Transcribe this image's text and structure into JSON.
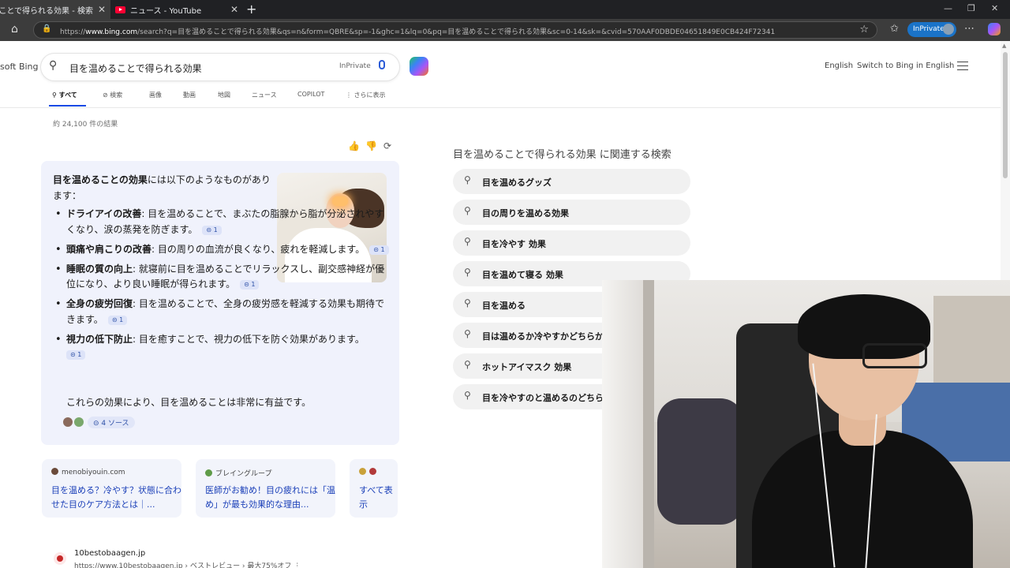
{
  "browser": {
    "tabs": [
      {
        "title": "目を温めることで得られる効果 - 検索"
      },
      {
        "title": "ニュース - YouTube"
      }
    ],
    "url": "https://www.bing.com/search?q=目を温めることで得られる効果&qs=n&form=QBRE&sp=-1&ghc=1&lq=0&pq=目を温めることで得られる効果&sc=0-14&sk=&cvid=570AAF0DBDE04651849E0CB424F72341",
    "url_domain": "www.bing.com",
    "url_prefix": "https://",
    "url_rest": "/search?q=目を温めることで得られる効果&qs=n&form=QBRE&sp=-1&ghc=1&lq=0&pq=目を温めることで得られる効果&sc=0-14&sk=&cvid=570AAF0DBDE04651849E0CB424F72341",
    "inprivate_label": "InPrivate"
  },
  "header": {
    "brand": "soft Bing",
    "query": "目を温めることで得られる効果",
    "inprivate": "InPrivate",
    "language": "English",
    "switch_link": "Switch to Bing in English"
  },
  "search_tabs": [
    "すべて",
    "検索",
    "画像",
    "動画",
    "地図",
    "ニュース",
    "COPILOT",
    "さらに表示"
  ],
  "result_count": "約 24,100 件の結果",
  "answer": {
    "intro_bold": "目を温めることの効果",
    "intro_rest": "には以下のようなものがあります：",
    "items": [
      {
        "title": "ドライアイの改善",
        "text": ": 目を温めることで、まぶたの脂腺から脂が分泌されやすくなり、涙の蒸発を防ぎます。",
        "cite": "1"
      },
      {
        "title": "頭痛や肩こりの改善",
        "text": ": 目の周りの血流が良くなり、疲れを軽減します。",
        "cite": "1"
      },
      {
        "title": "睡眠の質の向上",
        "text": ": 就寝前に目を温めることでリラックスし、副交感神経が優位になり、より良い睡眠が得られます。",
        "cite": "1"
      },
      {
        "title": "全身の疲労回復",
        "text": ": 目を温めることで、全身の疲労感を軽減する効果も期待できます。",
        "cite": "1"
      },
      {
        "title": "視力の低下防止",
        "text": ": 目を癒すことで、視力の低下を防ぐ効果があります。",
        "cite": "1"
      }
    ],
    "conclusion": "これらの効果により、目を温めることは非常に有益です。",
    "sources_label": "4 ソース"
  },
  "source_cards": [
    {
      "site": "menobiyouin.com",
      "title": "目を温める？冷やす？状態に合わせた目のケア方法とは｜..."
    },
    {
      "site": "ブレイングループ",
      "title": "医師がお勧め！目の疲れには「温め」が最も効果的な理由..."
    },
    {
      "site": "",
      "title": "すべて表示"
    }
  ],
  "result2": {
    "site": "10bestobaagen.jp",
    "url": "https://www.10bestobaagen.jp › ベストレビュー › 最大75%オフ ⋮"
  },
  "related": {
    "title": "目を温めることで得られる効果 に関連する検索",
    "items": [
      "目を温めるグッズ",
      "目の周りを温める効果",
      "目を冷やす 効果",
      "目を温めて寝る 効果",
      "目を温める",
      "目は温めるか冷やすかどちらか",
      "ホットアイマスク 効果",
      "目を冷やすのと温めるのどちら"
    ]
  },
  "icons": {
    "close": "✕",
    "new_tab": "+",
    "home": "⌂",
    "lock": "🔒",
    "star": "☆",
    "search": "⚲",
    "thumbs_up": "👍",
    "thumbs_down": "👎",
    "share": "⟳"
  },
  "colors": {
    "bing_blue": "#174ae4",
    "link_blue": "#1a3fb8",
    "answer_bg": "#f0f2fc",
    "inprivate_bg": "#1a73c8"
  }
}
